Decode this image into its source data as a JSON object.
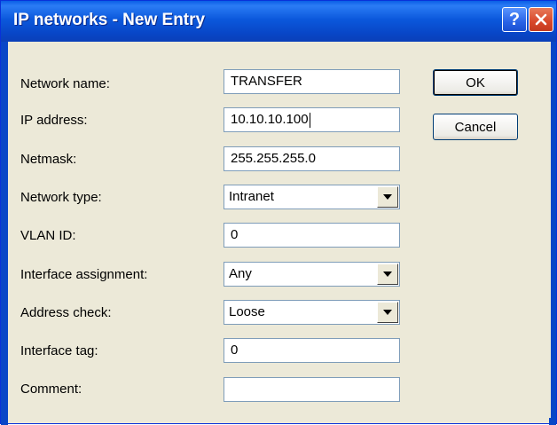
{
  "window": {
    "title": "IP networks - New Entry",
    "help_button": "?",
    "close_button": "close"
  },
  "buttons": {
    "ok_label": "OK",
    "cancel_label": "Cancel"
  },
  "form": {
    "network_name": {
      "label": "Network name:",
      "value": "TRANSFER"
    },
    "ip_address": {
      "label": "IP address:",
      "value": "10.10.10.100"
    },
    "netmask": {
      "label": "Netmask:",
      "value": "255.255.255.0"
    },
    "network_type": {
      "label": "Network type:",
      "value": "Intranet"
    },
    "vlan_id": {
      "label": "VLAN ID:",
      "value": "0"
    },
    "interface_assignment": {
      "label": "Interface assignment:",
      "value": "Any"
    },
    "address_check": {
      "label": "Address check:",
      "value": "Loose"
    },
    "interface_tag": {
      "label": "Interface tag:",
      "value": "0"
    },
    "comment": {
      "label": "Comment:",
      "value": ""
    }
  },
  "colors": {
    "titlebar": "#0846c7",
    "dialog_bg": "#ece9d8",
    "field_border": "#7f9db9",
    "close_red": "#d8472a"
  }
}
